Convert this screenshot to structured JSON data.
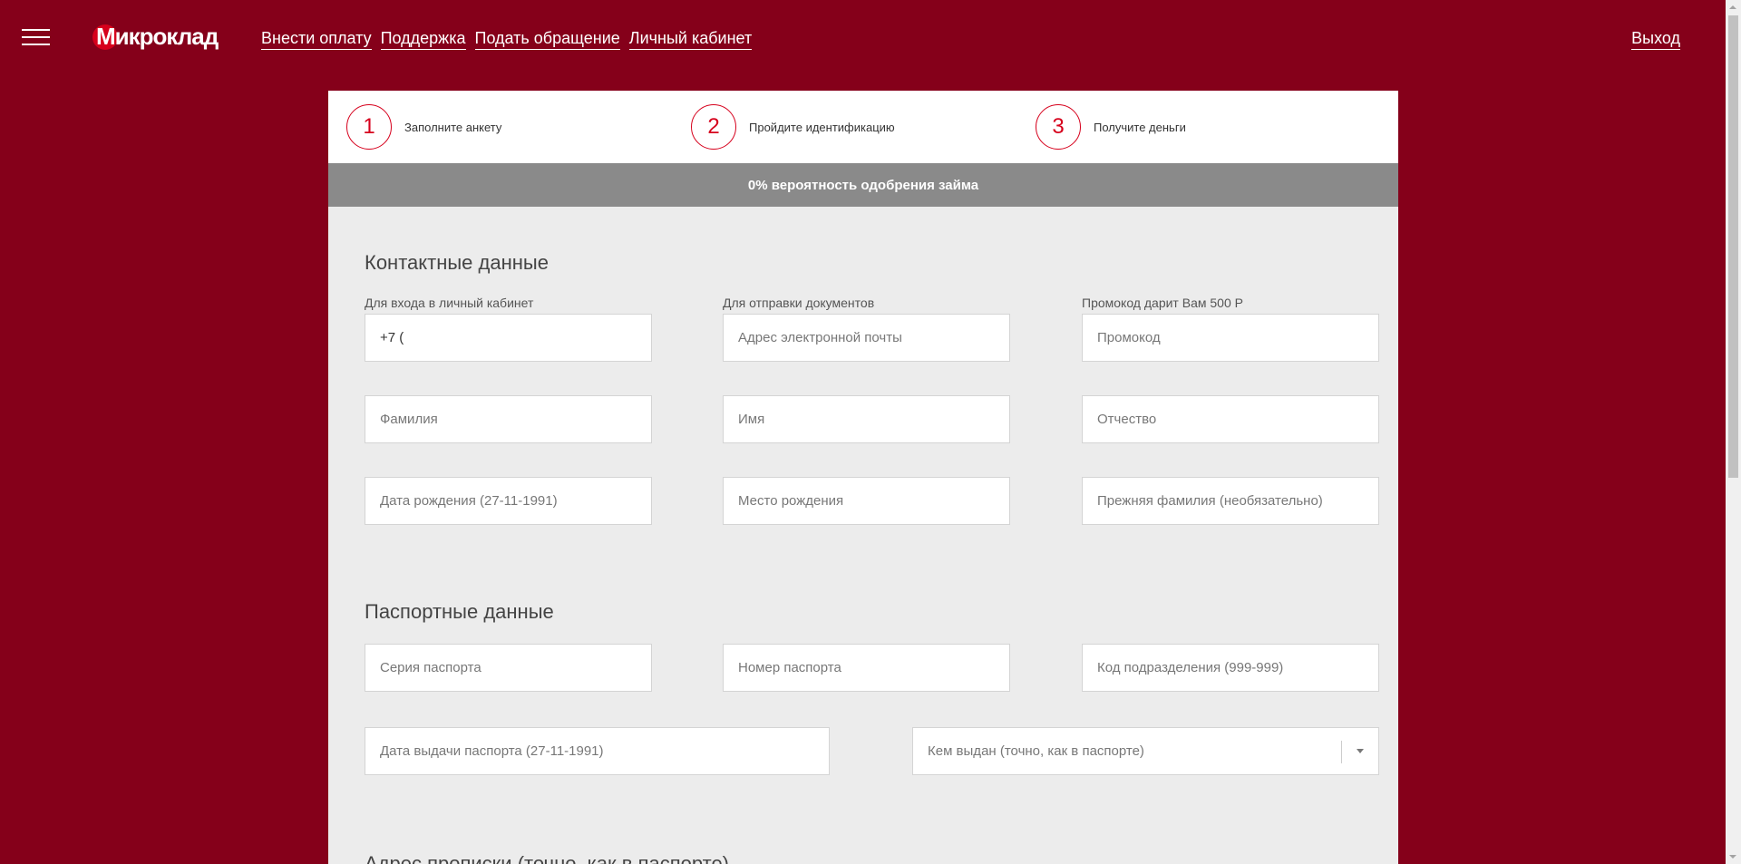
{
  "header": {
    "logo_text": "Микроклад",
    "nav": [
      {
        "label": "Внести оплату"
      },
      {
        "label": "Поддержка"
      },
      {
        "label": "Подать обращение"
      },
      {
        "label": "Личный кабинет"
      }
    ],
    "logout_label": "Выход"
  },
  "steps": [
    {
      "number": "1",
      "label": "Заполните анкету"
    },
    {
      "number": "2",
      "label": "Пройдите идентификацию"
    },
    {
      "number": "3",
      "label": "Получите деньги"
    }
  ],
  "approval_text": "0% вероятность одобрения займа",
  "contact": {
    "title": "Контактные данные",
    "hints": {
      "phone": "Для входа в личный кабинет",
      "email": "Для отправки документов",
      "promo": "Промокод дарит Вам 500 Р"
    },
    "phone_value": "+7 (",
    "email_placeholder": "Адрес электронной почты",
    "promo_placeholder": "Промокод",
    "surname_placeholder": "Фамилия",
    "name_placeholder": "Имя",
    "patronymic_placeholder": "Отчество",
    "birthdate_placeholder": "Дата рождения (27-11-1991)",
    "birthplace_placeholder": "Место рождения",
    "prev_surname_placeholder": "Прежняя фамилия (необязательно)"
  },
  "passport": {
    "title": "Паспортные данные",
    "series_placeholder": "Серия паспорта",
    "number_placeholder": "Номер паспорта",
    "dept_code_placeholder": "Код подразделения (999-999)",
    "issue_date_placeholder": "Дата выдачи паспорта (27-11-1991)",
    "issued_by_placeholder": "Кем выдан (точно, как в паспорте)"
  },
  "address": {
    "title": "Адрес прописки (точно, как в паспорте)"
  },
  "colors": {
    "background": "#85001a",
    "accent": "#d6001c",
    "approval_bar": "#8a8a8a",
    "form_bg": "#ececec"
  }
}
